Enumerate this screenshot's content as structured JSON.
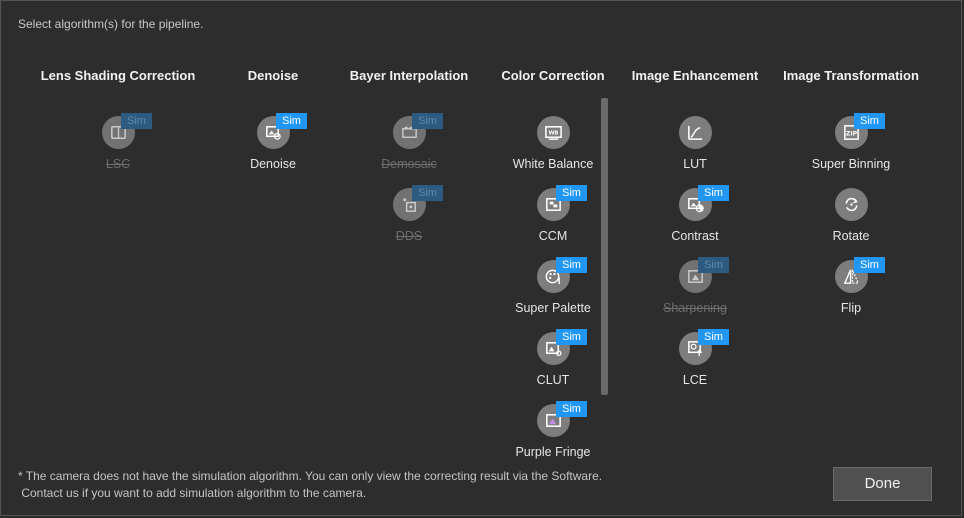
{
  "instruction": "Select algorithm(s) for the pipeline.",
  "sim_badge": "Sim",
  "columns": [
    {
      "title": "Lens Shading Correction",
      "items": [
        {
          "label": "LSC",
          "icon": "lsc-icon",
          "sim": true,
          "disabled": true
        }
      ]
    },
    {
      "title": "Denoise",
      "items": [
        {
          "label": "Denoise",
          "icon": "denoise-icon",
          "sim": true,
          "disabled": false
        }
      ]
    },
    {
      "title": "Bayer Interpolation",
      "items": [
        {
          "label": "Demosaic",
          "icon": "demosaic-icon",
          "sim": true,
          "disabled": true
        },
        {
          "label": "DDS",
          "icon": "dds-icon",
          "sim": true,
          "disabled": true
        }
      ]
    },
    {
      "title": "Color Correction",
      "items": [
        {
          "label": "White Balance",
          "icon": "white-balance-icon",
          "sim": false,
          "disabled": false
        },
        {
          "label": "CCM",
          "icon": "ccm-icon",
          "sim": true,
          "disabled": false
        },
        {
          "label": "Super Palette",
          "icon": "super-palette-icon",
          "sim": true,
          "disabled": false
        },
        {
          "label": "CLUT",
          "icon": "clut-icon",
          "sim": true,
          "disabled": false
        },
        {
          "label": "Purple Fringe",
          "icon": "purple-fringe-icon",
          "sim": true,
          "disabled": false
        }
      ]
    },
    {
      "title": "Image Enhancement",
      "items": [
        {
          "label": "LUT",
          "icon": "lut-icon",
          "sim": false,
          "disabled": false
        },
        {
          "label": "Contrast",
          "icon": "contrast-icon",
          "sim": true,
          "disabled": false
        },
        {
          "label": "Sharpening",
          "icon": "sharpening-icon",
          "sim": true,
          "disabled": true
        },
        {
          "label": "LCE",
          "icon": "lce-icon",
          "sim": true,
          "disabled": false
        }
      ]
    },
    {
      "title": "Image Transformation",
      "items": [
        {
          "label": "Super Binning",
          "icon": "super-binning-icon",
          "sim": true,
          "disabled": false
        },
        {
          "label": "Rotate",
          "icon": "rotate-icon",
          "sim": false,
          "disabled": false
        },
        {
          "label": "Flip",
          "icon": "flip-icon",
          "sim": true,
          "disabled": false
        }
      ]
    }
  ],
  "footnote": {
    "line1": "* The camera does not have the simulation algorithm. You can only view the correcting result via the Software.",
    "line2": " Contact us if you want to add simulation algorithm to the camera."
  },
  "done_label": "Done",
  "colors": {
    "background": "#2d2d2d",
    "sim_badge": "#2196f3",
    "icon_circle": "#7d7d7d"
  }
}
